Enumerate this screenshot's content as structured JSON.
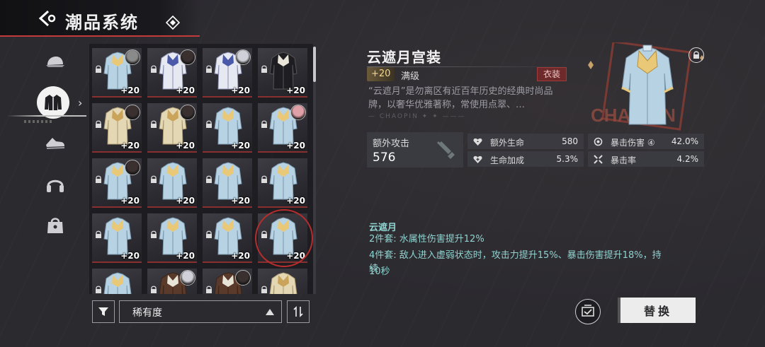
{
  "header": {
    "title": "潮品系统"
  },
  "categories": [
    {
      "name": "cap-icon",
      "active": false
    },
    {
      "name": "jacket-icon",
      "active": true
    },
    {
      "name": "shoes-icon",
      "active": false
    },
    {
      "name": "headphones-icon",
      "active": false
    },
    {
      "name": "bag-icon",
      "active": false
    }
  ],
  "grid": {
    "items": [
      {
        "style": "blue",
        "level": "+20",
        "avatar": "gray"
      },
      {
        "style": "white",
        "level": "+20",
        "avatar": "dark"
      },
      {
        "style": "white",
        "level": "+20",
        "avatar": "silver"
      },
      {
        "style": "dark",
        "level": "+20",
        "avatar": ""
      },
      {
        "style": "beige",
        "level": "+20",
        "avatar": "dark"
      },
      {
        "style": "beige",
        "level": "+20",
        "avatar": "dark"
      },
      {
        "style": "blue",
        "level": "+20",
        "avatar": ""
      },
      {
        "style": "blue",
        "level": "+20",
        "avatar": "pink"
      },
      {
        "style": "blue",
        "level": "+20",
        "avatar": "dark"
      },
      {
        "style": "blue",
        "level": "+20",
        "avatar": ""
      },
      {
        "style": "blue",
        "level": "+20",
        "avatar": ""
      },
      {
        "style": "blue",
        "level": "+20",
        "avatar": ""
      },
      {
        "style": "blue",
        "level": "+20",
        "avatar": ""
      },
      {
        "style": "blue",
        "level": "+20",
        "avatar": ""
      },
      {
        "style": "blue",
        "level": "+20",
        "avatar": ""
      },
      {
        "style": "blue",
        "level": "+20",
        "avatar": "",
        "selected": true
      },
      {
        "style": "blue",
        "level": "",
        "avatar": ""
      },
      {
        "style": "brown",
        "level": "",
        "avatar": "silver"
      },
      {
        "style": "brown",
        "level": "",
        "avatar": "dark"
      },
      {
        "style": "beige",
        "level": "",
        "avatar": ""
      }
    ]
  },
  "filter": {
    "sort_value": "稀有度"
  },
  "detail": {
    "name": "云遮月宫装",
    "level": "+20",
    "level_text": "满级",
    "type_tag": "衣装",
    "description": "“云遮月”是勿离区有近百年历史的经典时尚品牌，以奢华优雅著称，常使用点翠、…",
    "brand_strip": "— CHAOPIN ✦ ✦ ———",
    "art_label": "CHAOPIN",
    "main_stat": {
      "label": "额外攻击",
      "value": "576"
    },
    "stats": [
      {
        "icon": "heart-icon",
        "label": "额外生命",
        "value": "580"
      },
      {
        "icon": "crit-damage-icon",
        "label": "暴击伤害 ④",
        "value": "42.0%"
      },
      {
        "icon": "heart-plus-icon",
        "label": "生命加成",
        "value": "5.3%"
      },
      {
        "icon": "crit-rate-icon",
        "label": "暴击率",
        "value": "4.2%"
      }
    ],
    "set": {
      "name": "云遮月",
      "two_piece": "2件套: 水属性伤害提升12%",
      "four_piece": "4件套: 敌人进入虚弱状态时，攻击力提升15%、暴击伤害提升18%，持续",
      "four_piece_cont": "10秒"
    }
  },
  "buttons": {
    "replace": "替换"
  },
  "colors": {
    "accent_red": "#c23a3a",
    "set_text": "#8fd3d0",
    "badge_gold": "#f5d68c"
  }
}
